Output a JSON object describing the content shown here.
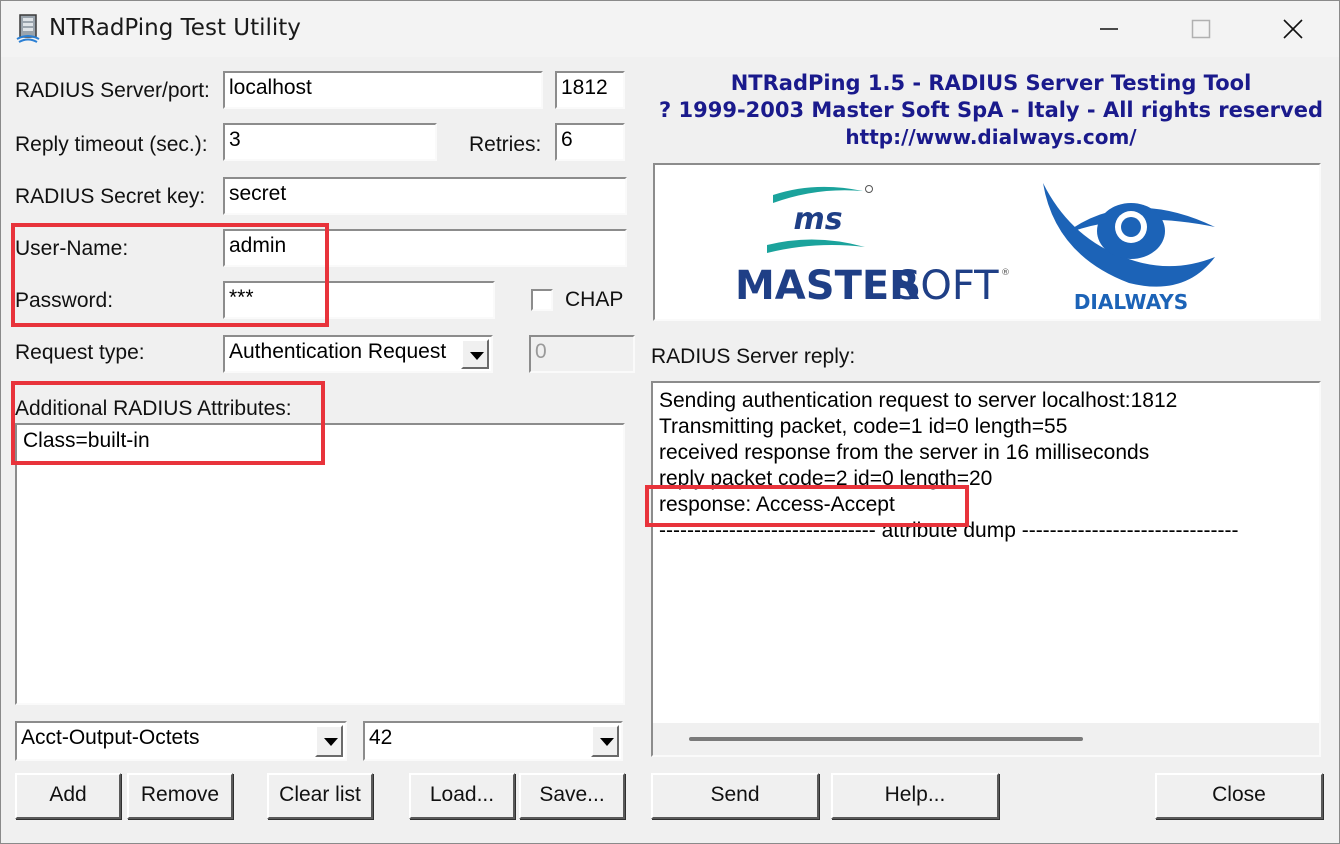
{
  "window": {
    "title": "NTRadPing Test Utility"
  },
  "form": {
    "server_label": "RADIUS Server/port:",
    "server_value": "localhost",
    "port_value": "1812",
    "timeout_label": "Reply timeout (sec.):",
    "timeout_value": "3",
    "retries_label": "Retries:",
    "retries_value": "6",
    "secret_label": "RADIUS Secret key:",
    "secret_value": "secret",
    "username_label": "User-Name:",
    "username_value": "admin",
    "password_label": "Password:",
    "password_value": "***",
    "chap_label": "CHAP",
    "chap_checked": false,
    "request_type_label": "Request type:",
    "request_type_value": "Authentication Request",
    "request_code_value": "0",
    "attributes_label": "Additional RADIUS Attributes:",
    "attributes": [
      "Class=built-in"
    ],
    "attr_name_value": "Acct-Output-Octets",
    "attr_id_value": "42"
  },
  "buttons": {
    "add": "Add",
    "remove": "Remove",
    "clear_list": "Clear list",
    "load": "Load...",
    "save": "Save...",
    "send": "Send",
    "help": "Help...",
    "close": "Close"
  },
  "header": {
    "line1": "NTRadPing 1.5 - RADIUS Server Testing Tool",
    "line2": "? 1999-2003 Master Soft SpA - Italy - All rights reserved",
    "line3": "http://www.dialways.com/"
  },
  "logos": {
    "mastersoft_mark": "ms",
    "mastersoft_name_bold": "MASTER",
    "mastersoft_name_light": "SOFT",
    "dialways_name": "DIALWAYS"
  },
  "reply": {
    "label": "RADIUS Server reply:",
    "lines": [
      "Sending authentication request to server localhost:1812",
      "Transmitting packet, code=1 id=0 length=55",
      "received response from the server in 16 milliseconds",
      "reply packet code=2 id=0 length=20",
      "response: Access-Accept",
      "------------------------------- attribute dump -------------------------------"
    ]
  },
  "colors": {
    "header_text": "#1a1a8c",
    "highlight": "#e8333b",
    "mastersoft_blue": "#1f3f86",
    "mastersoft_teal": "#1ba39c",
    "dialways_blue": "#1c63b7"
  }
}
